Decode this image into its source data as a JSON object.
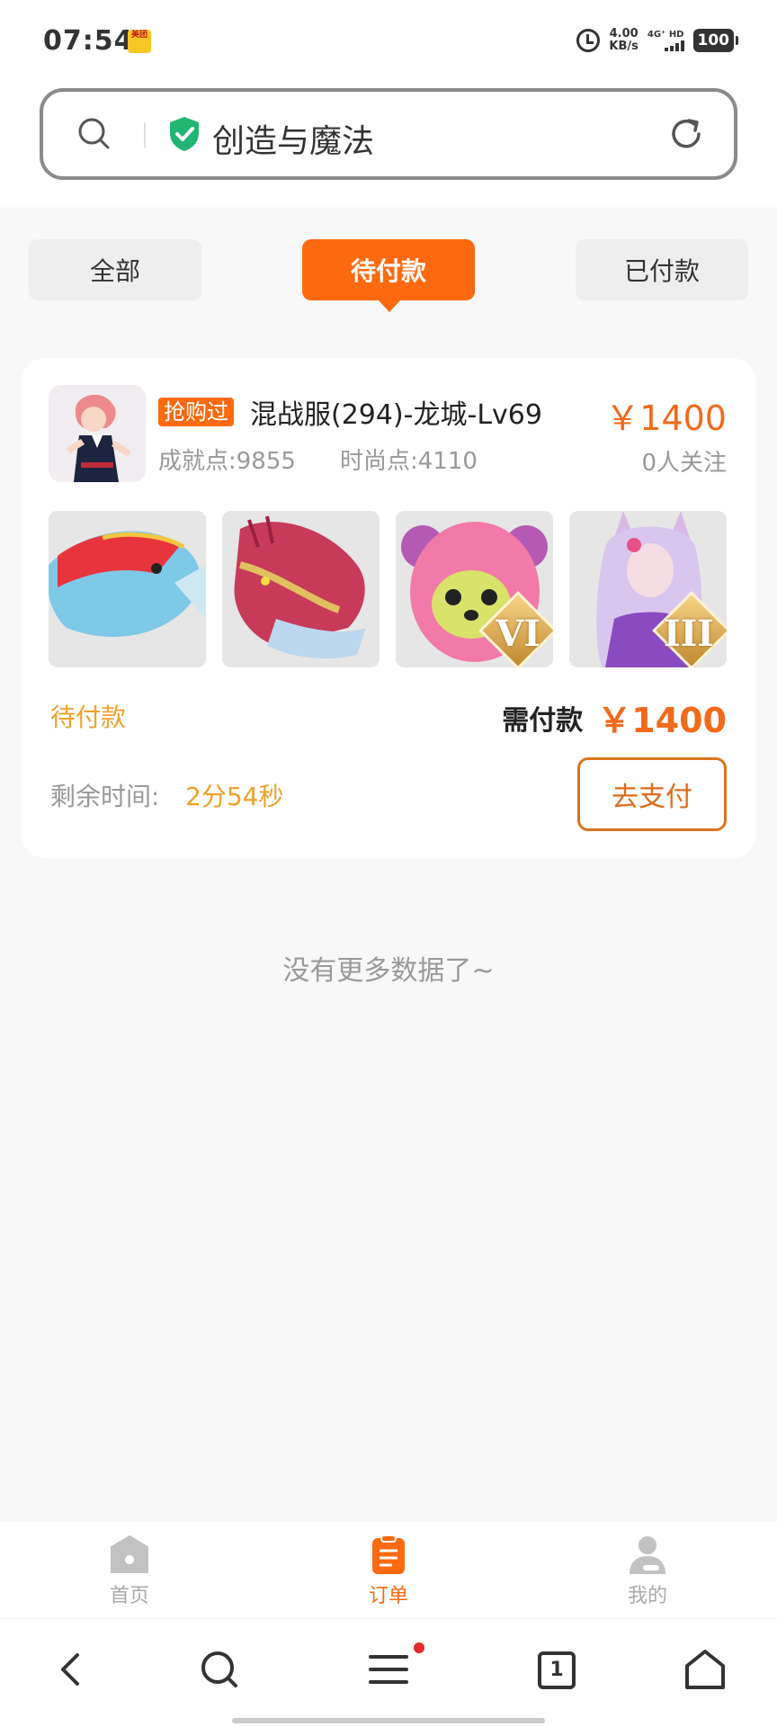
{
  "status_bar": {
    "time": "07:54",
    "app_badge": "美团",
    "speed_value": "4.00",
    "speed_unit": "KB/s",
    "network": "4G⁺ HD",
    "battery": "100"
  },
  "search": {
    "text": "创造与魔法"
  },
  "tabs": {
    "all": "全部",
    "pending": "待付款",
    "paid": "已付款"
  },
  "order": {
    "tag": "抢购过",
    "title": "混战服(294)-龙城-Lv69",
    "price": "￥1400",
    "achievement": "成就点:9855",
    "fashion": "时尚点:4110",
    "followers": "0人关注",
    "thumbs": [
      {
        "name": "fish-mount",
        "rank": ""
      },
      {
        "name": "dragon-mount",
        "rank": ""
      },
      {
        "name": "pink-bear-pet",
        "rank": "VI"
      },
      {
        "name": "fox-girl-fashion",
        "rank": "III"
      }
    ],
    "status": "待付款",
    "need_pay_label": "需付款",
    "need_pay_value": "￥1400",
    "remain_label": "剩余时间:",
    "remain_value": "2分54秒",
    "pay_button": "去支付"
  },
  "no_more": "没有更多数据了~",
  "bottom_nav": {
    "home": "首页",
    "orders": "订单",
    "mine": "我的"
  },
  "browser_bar": {
    "tab_count": "1"
  },
  "colors": {
    "accent": "#fd6a10",
    "price": "#f26a1b",
    "status": "#f0a02a",
    "shield": "#22b573"
  }
}
